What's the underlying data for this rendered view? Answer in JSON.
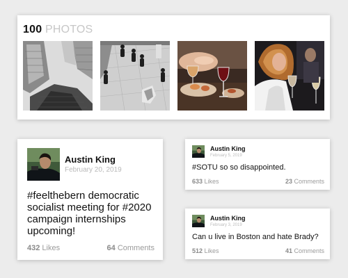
{
  "photos": {
    "count": "100",
    "label": "PHOTOS",
    "items": [
      {
        "icon": "skyscrapers-photo"
      },
      {
        "icon": "plaza-walkers-photo"
      },
      {
        "icon": "dinner-wine-photo"
      },
      {
        "icon": "party-guests-photo"
      }
    ]
  },
  "posts": [
    {
      "author": "Austin King",
      "date": "February 20, 2019",
      "text": "#feelthebern democratic socialist meeting for #2020 campaign internships upcoming!",
      "likes_count": "432",
      "likes_label": "Likes",
      "comments_count": "64",
      "comments_label": "Comments"
    },
    {
      "author": "Austin King",
      "date": "February 5, 2019",
      "text": "#SOTU so so disappointed.",
      "likes_count": "633",
      "likes_label": "Likes",
      "comments_count": "23",
      "comments_label": "Comments"
    },
    {
      "author": "Austin King",
      "date": "February 3, 2019",
      "text": "Can u live in Boston and hate Brady?",
      "likes_count": "512",
      "likes_label": "Likes",
      "comments_count": "41",
      "comments_label": "Comments"
    }
  ]
}
